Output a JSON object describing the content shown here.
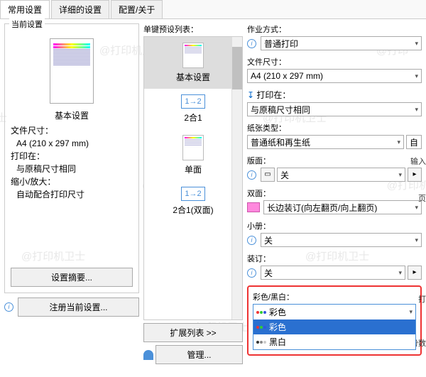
{
  "tabs": {
    "t0": "常用设置",
    "t1": "详细的设置",
    "t2": "配置/关于"
  },
  "left": {
    "legend": "当前设置",
    "preset_name": "基本设置",
    "info_line1": "文件尺寸：",
    "info_val1": "A4 (210 x 297 mm)",
    "info_line2": "打印在：",
    "info_val2": "与原稿尺寸相同",
    "info_line3": "缩小/放大：",
    "info_val3": "自动配合打印尺寸",
    "btn_summary": "设置摘要...",
    "btn_register": "注册当前设置..."
  },
  "presets": {
    "title": "单键预设列表：",
    "i0": "基本设置",
    "i1": "2合1",
    "i2": "单面",
    "i3": "2合1(双面)",
    "arrow": "1→2",
    "btn_expand": "扩展列表 >>",
    "btn_manage": "管理..."
  },
  "right": {
    "job_label": "作业方式：",
    "job": "普通打印",
    "size_label": "文件尺寸：",
    "size": "A4 (210 x 297 mm)",
    "printon_label": "打印在：",
    "printon": "与原稿尺寸相同",
    "paper_label": "纸张类型：",
    "paper": "普通纸和再生纸",
    "input_label": "输入",
    "layout_label": "版面：",
    "layout": "关",
    "page_label": "页",
    "duplex_label": "双面：",
    "duplex": "长边装订(向左翻页/向上翻页)",
    "booklet_label": "小册：",
    "booklet": "关",
    "bind_label": "装订：",
    "bind": "关",
    "staple_label": "打",
    "color_label": "彩色/黑白：",
    "copies_label": "份数",
    "color_opts": {
      "o0": "彩色",
      "o1": "彩色",
      "o2": "黑白"
    }
  }
}
